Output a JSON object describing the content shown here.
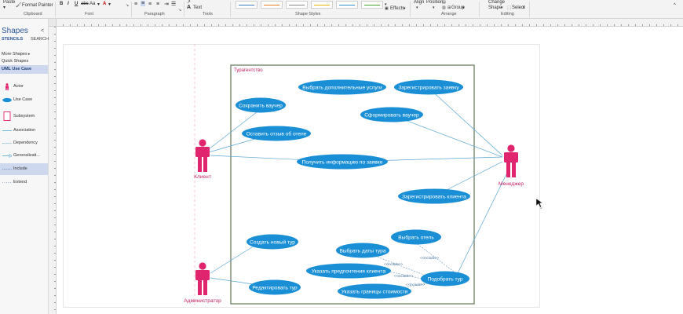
{
  "ribbon": {
    "paste_label": "Paste",
    "format_painter_label": "Format Painter",
    "clipboard_group": "Clipboard",
    "font_group": "Font",
    "paragraph_group": "Paragraph",
    "tools_group": "Tools",
    "text_tool_label": "Text",
    "shape_styles_group": "Shape Styles",
    "effects_label": "Effects",
    "align_label": "Align",
    "position_label": "Position",
    "group_label": "Group",
    "arrange_group": "Arrange",
    "change_shape_label": "Change",
    "change_shape_label2": "Shape",
    "select_label": "Select",
    "editing_group": "Editing",
    "bold_label": "B",
    "italic_label": "I",
    "underline_label": "U",
    "strike_label": "abc",
    "case_label": "Aa",
    "font_color_label": "A"
  },
  "shapes_pane": {
    "title": "Shapes",
    "tabs": [
      "STENCILS",
      "SEARCH"
    ],
    "more_shapes": "More Shapes",
    "quick_shapes": "Quick Shapes",
    "selected_category": "UML Use Case",
    "stencil_items": [
      {
        "label": "Actor",
        "icon": "actor-icon"
      },
      {
        "label": "Use Case",
        "icon": "use-case-icon"
      },
      {
        "label": "Subsystem",
        "icon": "subsystem-icon"
      },
      {
        "label": "Association",
        "icon": "association-icon"
      },
      {
        "label": "Dependency",
        "icon": "dependency-icon"
      },
      {
        "label": "Generalizati...",
        "icon": "generalization-icon"
      },
      {
        "label": "Include",
        "icon": "include-icon"
      },
      {
        "label": "Extend",
        "icon": "extend-icon"
      }
    ]
  },
  "diagram": {
    "system_boundary_label": "Турагентство",
    "actors": {
      "client": "Клиент",
      "manager": "Менеджер",
      "admin": "Администратор"
    },
    "use_cases": {
      "extra_services": "Выбрать дополнительные услуги",
      "register_request": "Зарегистрировать заявку",
      "save_voucher": "Сохранить ваучер",
      "form_voucher": "Сформировать ваучер",
      "leave_review": "Оставить отзыв об отеле",
      "get_info": "Получить информацию по заявке",
      "register_client": "Зарегистрировать клиента",
      "select_hotel": "Выбрать отель",
      "create_tour": "Создать новый тур",
      "tour_dates": "Выбрать даты тура",
      "client_prefs": "Указать предпочтения клиента",
      "pick_tour": "Подобрать тур",
      "edit_tour": "Редактировать тур",
      "price_limits": "Указать границы стоимости"
    },
    "include_label": "<<include>>"
  },
  "colors": {
    "use_case_fill": "#1a8fd6",
    "actor_fill": "#e0246e",
    "actor_label": "#c21d63",
    "boundary_stroke": "#6d7f63",
    "connector": "#5aa7d6",
    "accent": "#2b579a"
  }
}
